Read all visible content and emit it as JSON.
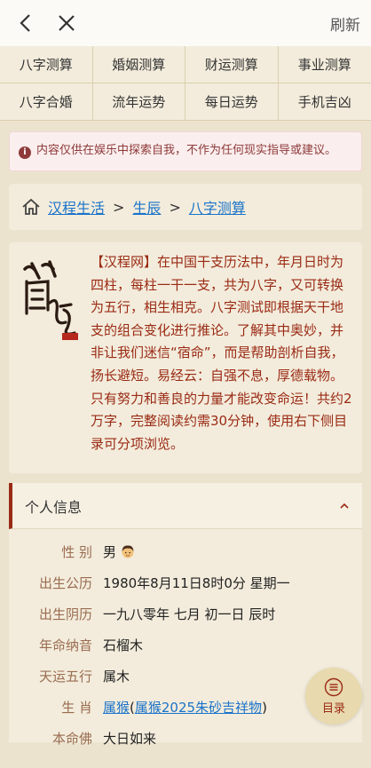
{
  "topbar": {
    "refresh_label": "刷新"
  },
  "nav": {
    "items": [
      "八字测算",
      "婚姻测算",
      "财运测算",
      "事业测算",
      "八字合婚",
      "流年运势",
      "每日运势",
      "手机吉凶"
    ]
  },
  "notice": {
    "text": "内容仅供在娱乐中探索自我，不作为任何现实指导或建议。"
  },
  "breadcrumb": {
    "items": [
      "汉程生活",
      "生辰",
      "八字测算"
    ],
    "separator": ">"
  },
  "intro": {
    "text": "【汉程网】在中国干支历法中，年月日时为四柱，每柱一干一支，共为八字，又可转换为五行，相生相克。八字测试即根据天干地支的组合变化进行推论。了解其中奥妙，并非让我们迷信“宿命”，而是帮助剖析自我，扬长避短。易经云：自强不息，厚德载物。只有努力和善良的力量才能改变命运！共约2万字，完整阅读约需30分钟，使用右下侧目录可分项浏览。"
  },
  "section": {
    "title": "个人信息"
  },
  "info": {
    "gender": {
      "label": "性 别",
      "value": "男"
    },
    "solar": {
      "label": "出生公历",
      "value": "1980年8月11日8时0分 星期一"
    },
    "lunar": {
      "label": "出生阴历",
      "value": "一九八零年 七月 初一日 辰时"
    },
    "nayin": {
      "label": "年命纳音",
      "value": "石榴木"
    },
    "wuxing": {
      "label": "天运五行",
      "value": "属木"
    },
    "zodiac": {
      "label": "生 肖",
      "link1": "属猴",
      "paren_open": "(",
      "link2": "属猴2025朱砂吉祥物",
      "paren_close": ")"
    },
    "buddha": {
      "label": "本命佛",
      "value": "大日如来"
    }
  },
  "toc": {
    "label": "目录"
  },
  "colors": {
    "accent": "#9a2a14",
    "link": "#1a73c9",
    "background": "#ece3cf"
  }
}
